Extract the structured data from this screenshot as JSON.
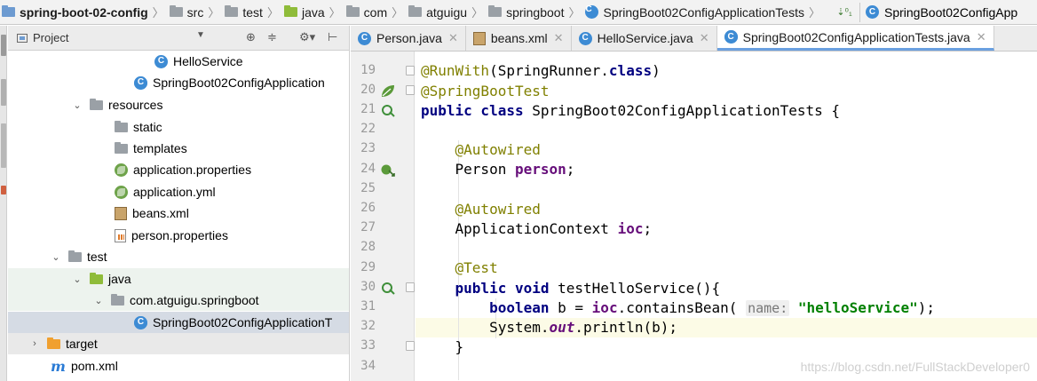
{
  "breadcrumb": [
    "spring-boot-02-config",
    "src",
    "test",
    "java",
    "com",
    "atguigu",
    "springboot",
    "SpringBoot02ConfigApplicationTests"
  ],
  "run_config": "SpringBoot02ConfigApp",
  "project_panel": {
    "title": "Project",
    "tree": [
      {
        "label": "HelloService",
        "icon": "class-icon"
      },
      {
        "label": "SpringBoot02ConfigApplication",
        "icon": "spring-boot-class-icon"
      },
      {
        "label": "resources",
        "icon": "resources-folder-icon",
        "expanded": true
      },
      {
        "label": "static",
        "icon": "folder-icon"
      },
      {
        "label": "templates",
        "icon": "folder-icon"
      },
      {
        "label": "application.properties",
        "icon": "spring-properties-icon"
      },
      {
        "label": "application.yml",
        "icon": "spring-yml-icon"
      },
      {
        "label": "beans.xml",
        "icon": "xml-icon"
      },
      {
        "label": "person.properties",
        "icon": "properties-icon"
      },
      {
        "label": "test",
        "icon": "folder-icon",
        "expanded": true
      },
      {
        "label": "java",
        "icon": "test-source-folder-icon",
        "expanded": true
      },
      {
        "label": "com.atguigu.springboot",
        "icon": "package-icon",
        "expanded": true
      },
      {
        "label": "SpringBoot02ConfigApplicationT",
        "icon": "spring-boot-class-icon"
      },
      {
        "label": "target",
        "icon": "excluded-folder-icon",
        "expanded": false
      },
      {
        "label": "pom.xml",
        "icon": "maven-icon"
      }
    ]
  },
  "tabs": [
    {
      "label": "Person.java",
      "icon": "class-icon"
    },
    {
      "label": "beans.xml",
      "icon": "xml-icon"
    },
    {
      "label": "HelloService.java",
      "icon": "class-icon"
    },
    {
      "label": "SpringBoot02ConfigApplicationTests.java",
      "icon": "spring-boot-class-icon",
      "active": true
    }
  ],
  "editor": {
    "lines": [
      {
        "n": "19",
        "text": "@RunWith(SpringRunner.class)"
      },
      {
        "n": "20",
        "text": "@SpringBootTest"
      },
      {
        "n": "21",
        "text": "public class SpringBoot02ConfigApplicationTests {"
      },
      {
        "n": "22",
        "text": ""
      },
      {
        "n": "23",
        "text": "    @Autowired"
      },
      {
        "n": "24",
        "text": "    Person person;"
      },
      {
        "n": "25",
        "text": ""
      },
      {
        "n": "26",
        "text": "    @Autowired"
      },
      {
        "n": "27",
        "text": "    ApplicationContext ioc;"
      },
      {
        "n": "28",
        "text": ""
      },
      {
        "n": "29",
        "text": "    @Test"
      },
      {
        "n": "30",
        "text": "    public void testHelloService(){"
      },
      {
        "n": "31",
        "text": "        boolean b = ioc.containsBean( name: \"helloService\");"
      },
      {
        "n": "32",
        "text": "        System.out.println(b);"
      },
      {
        "n": "33",
        "text": "    }"
      },
      {
        "n": "34",
        "text": ""
      }
    ],
    "parameter_hint": "name:"
  },
  "watermark": "https://blog.csdn.net/FullStackDeveloper0"
}
